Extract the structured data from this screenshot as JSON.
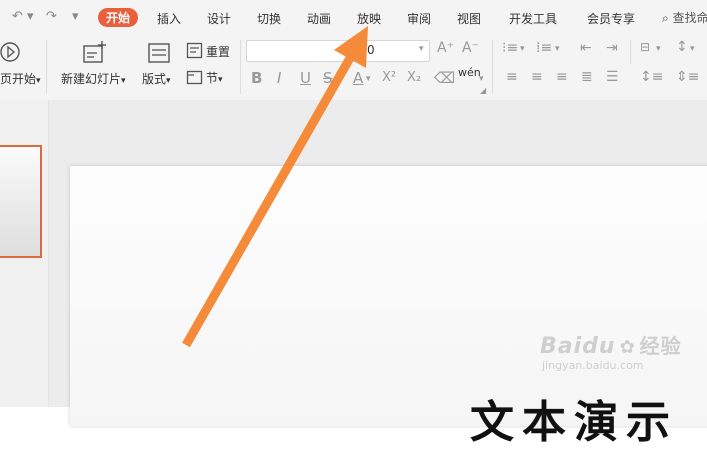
{
  "menubar": {
    "tabs": [
      "开始",
      "插入",
      "设计",
      "切换",
      "动画",
      "放映",
      "审阅",
      "视图",
      "开发工具",
      "会员专享"
    ],
    "active_tab": "开始",
    "search_text": "查找命"
  },
  "ribbon": {
    "play_label": "页开始",
    "new_slide_label": "新建幻灯片",
    "layout_label": "版式",
    "reset_label": "重置",
    "section_label": "节",
    "font_size_value": "0",
    "text_buttons": [
      "B",
      "I",
      "U",
      "S",
      "A",
      "X²",
      "X₂"
    ],
    "pinyin_label": "wén"
  },
  "slide": {
    "title_partial": "文本演示"
  },
  "watermark": {
    "brand": "Baidu",
    "brand_cn": "经验",
    "url": "jingyan.baidu.com"
  },
  "colors": {
    "accent": "#e8603c",
    "arrow": "#f58b3a",
    "thumb_border": "#d86c3c"
  }
}
